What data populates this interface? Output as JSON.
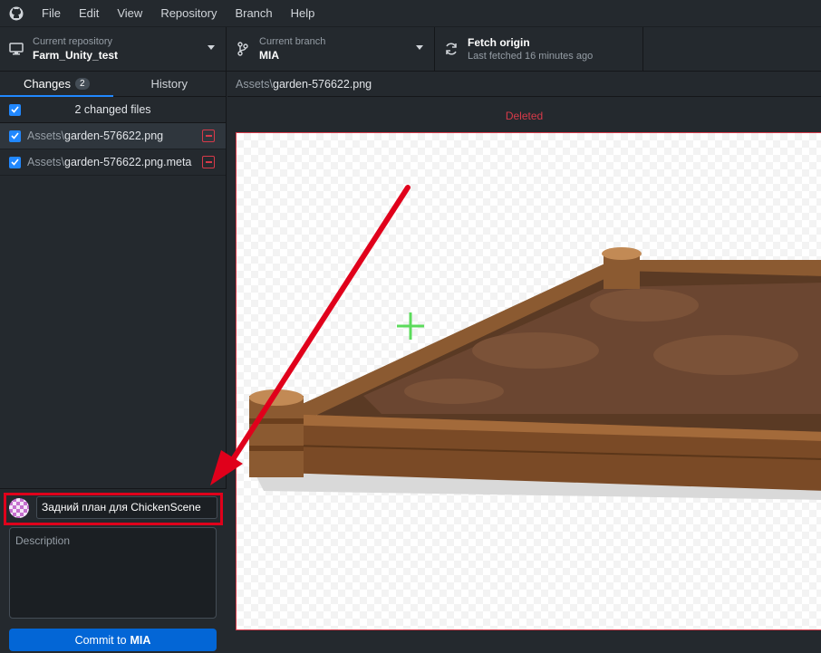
{
  "menubar": {
    "items": [
      "File",
      "Edit",
      "View",
      "Repository",
      "Branch",
      "Help"
    ]
  },
  "toolbar": {
    "repo": {
      "label": "Current repository",
      "value": "Farm_Unity_test"
    },
    "branch": {
      "label": "Current branch",
      "value": "MIA"
    },
    "fetch": {
      "label": "Fetch origin",
      "sub": "Last fetched 16 minutes ago"
    }
  },
  "sidebar": {
    "tabs": [
      {
        "label": "Changes",
        "badge": "2"
      },
      {
        "label": "History"
      }
    ],
    "changed_header": "2 changed files",
    "files": [
      {
        "dir": "Assets\\",
        "name": "garden-576622.png",
        "status": "deleted"
      },
      {
        "dir": "Assets\\",
        "name": "garden-576622.png.meta",
        "status": "deleted"
      }
    ]
  },
  "commit": {
    "summary_value": "Задний план для ChickenScene",
    "description_placeholder": "Description",
    "button_prefix": "Commit to",
    "button_branch": "MIA"
  },
  "diff": {
    "path_dir": "Assets\\",
    "path_file": "garden-576622.png",
    "status_label": "Deleted"
  },
  "colors": {
    "accent": "#2188ff",
    "commit_button": "#0366d6",
    "deleted": "#d73a49",
    "annotation": "#e0001b"
  }
}
